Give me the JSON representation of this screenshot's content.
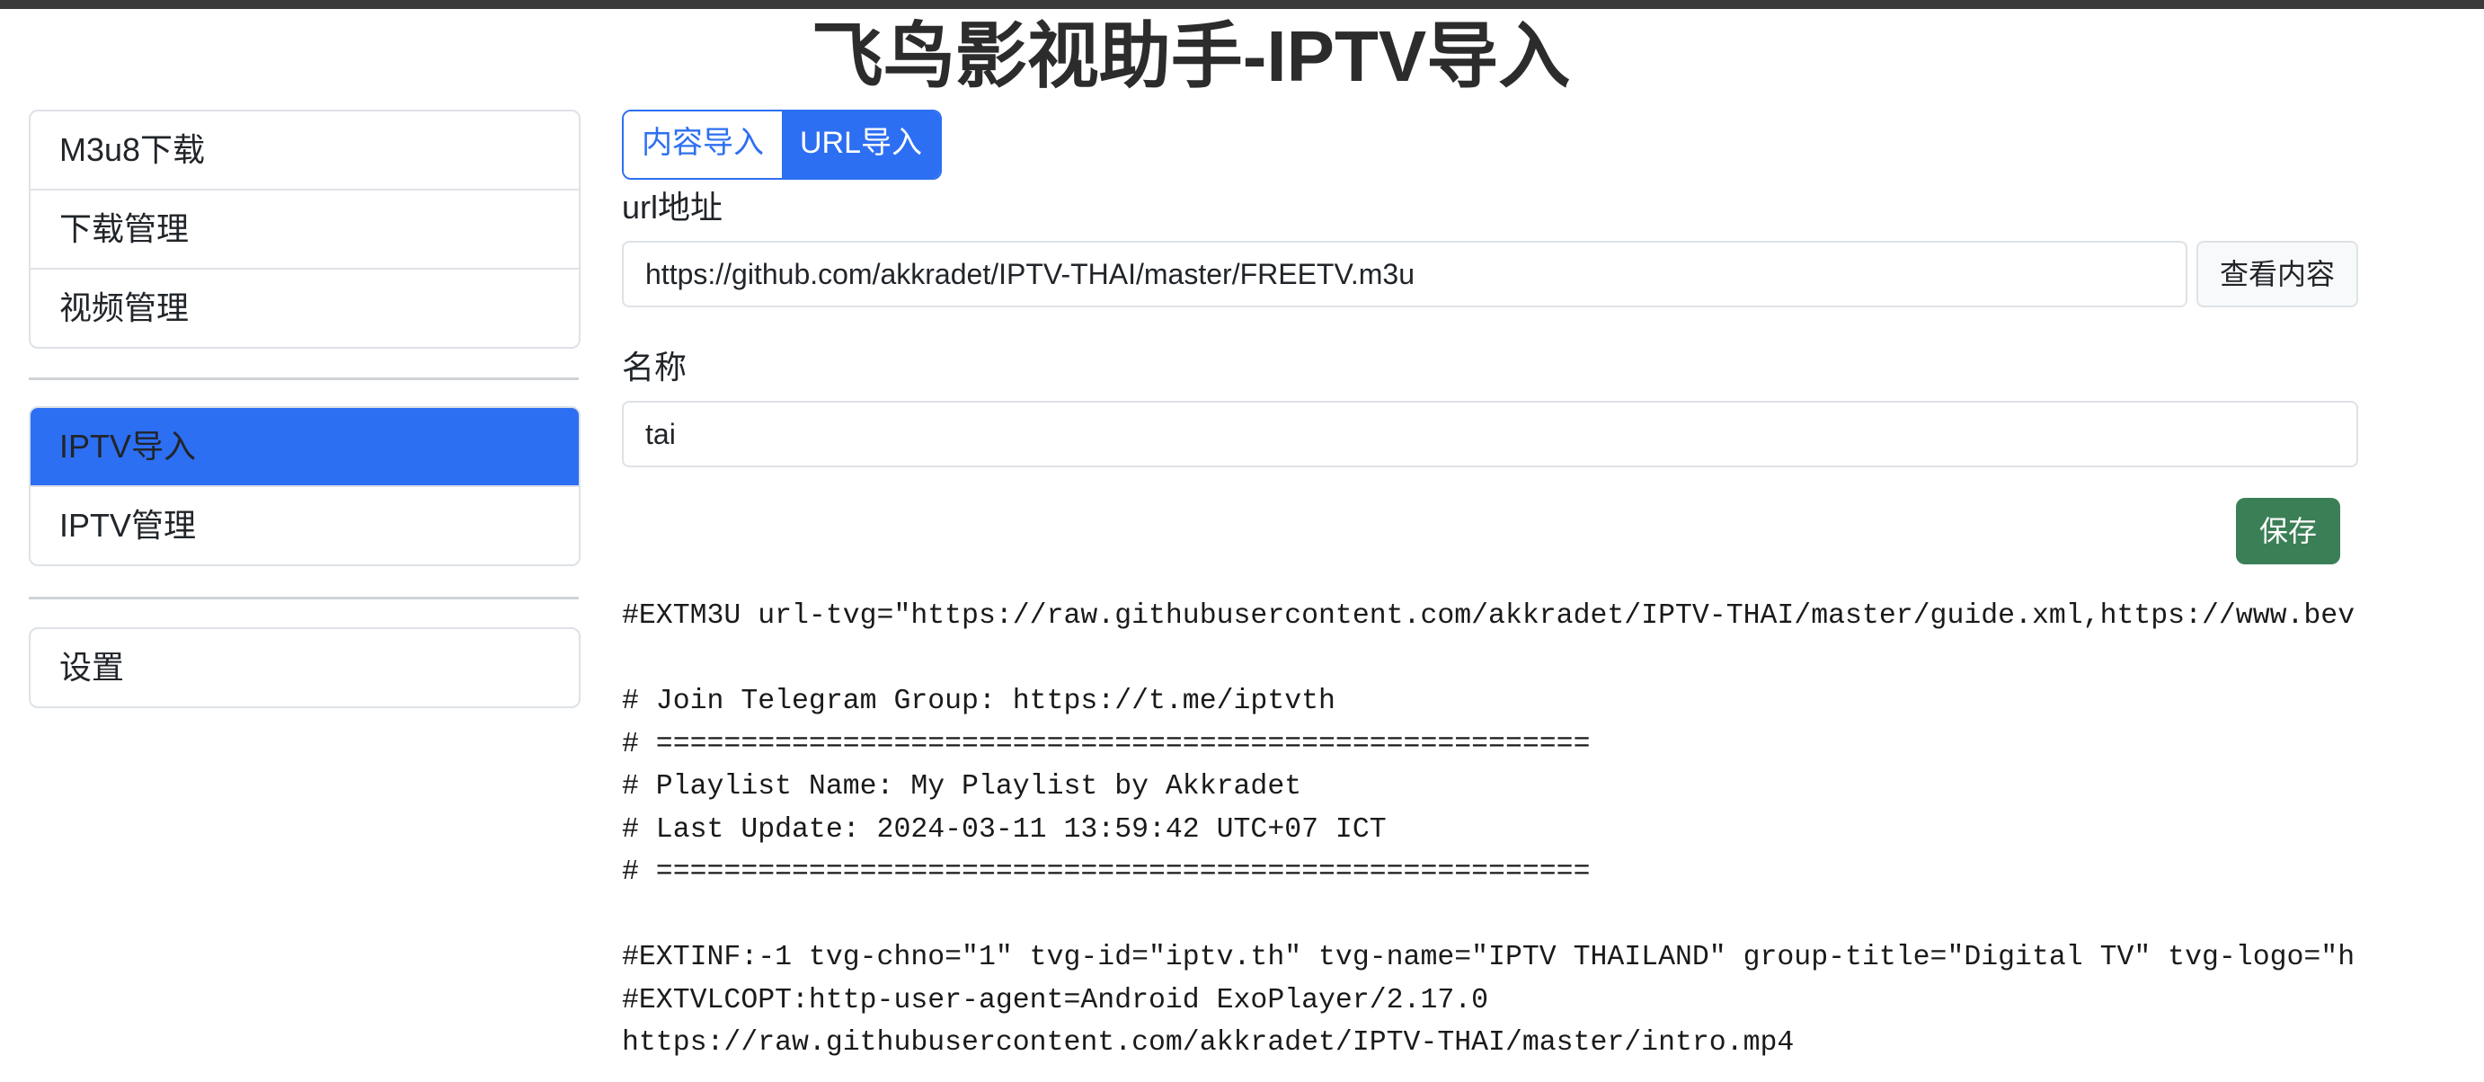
{
  "app": {
    "title": "飞鸟影视助手-IPTV导入"
  },
  "sidebar": {
    "group1": [
      {
        "label": "M3u8下载"
      },
      {
        "label": "下载管理"
      },
      {
        "label": "视频管理"
      }
    ],
    "group2": [
      {
        "label": "IPTV导入",
        "active": true
      },
      {
        "label": "IPTV管理"
      }
    ],
    "group3": [
      {
        "label": "设置"
      }
    ]
  },
  "tabs": [
    {
      "label": "内容导入"
    },
    {
      "label": "URL导入",
      "active": true
    }
  ],
  "form": {
    "url_label": "url地址",
    "url_value": "https://github.com/akkradet/IPTV-THAI/master/FREETV.m3u",
    "view_button": "查看内容",
    "name_label": "名称",
    "name_value": "tai",
    "save_button": "保存"
  },
  "content": {
    "lines": [
      "#EXTM3U url-tvg=\"https://raw.githubusercontent.com/akkradet/IPTV-THAI/master/guide.xml,https://www.bev",
      "",
      "# Join Telegram Group: https://t.me/iptvth",
      "# =======================================================",
      "# Playlist Name: My Playlist by Akkradet",
      "# Last Update: 2024-03-11 13:59:42 UTC+07 ICT",
      "# =======================================================",
      "",
      "#EXTINF:-1 tvg-chno=\"1\" tvg-id=\"iptv.th\" tvg-name=\"IPTV THAILAND\" group-title=\"Digital TV\" tvg-logo=\"h",
      "#EXTVLCOPT:http-user-agent=Android ExoPlayer/2.17.0",
      "https://raw.githubusercontent.com/akkradet/IPTV-THAI/master/intro.mp4"
    ]
  }
}
